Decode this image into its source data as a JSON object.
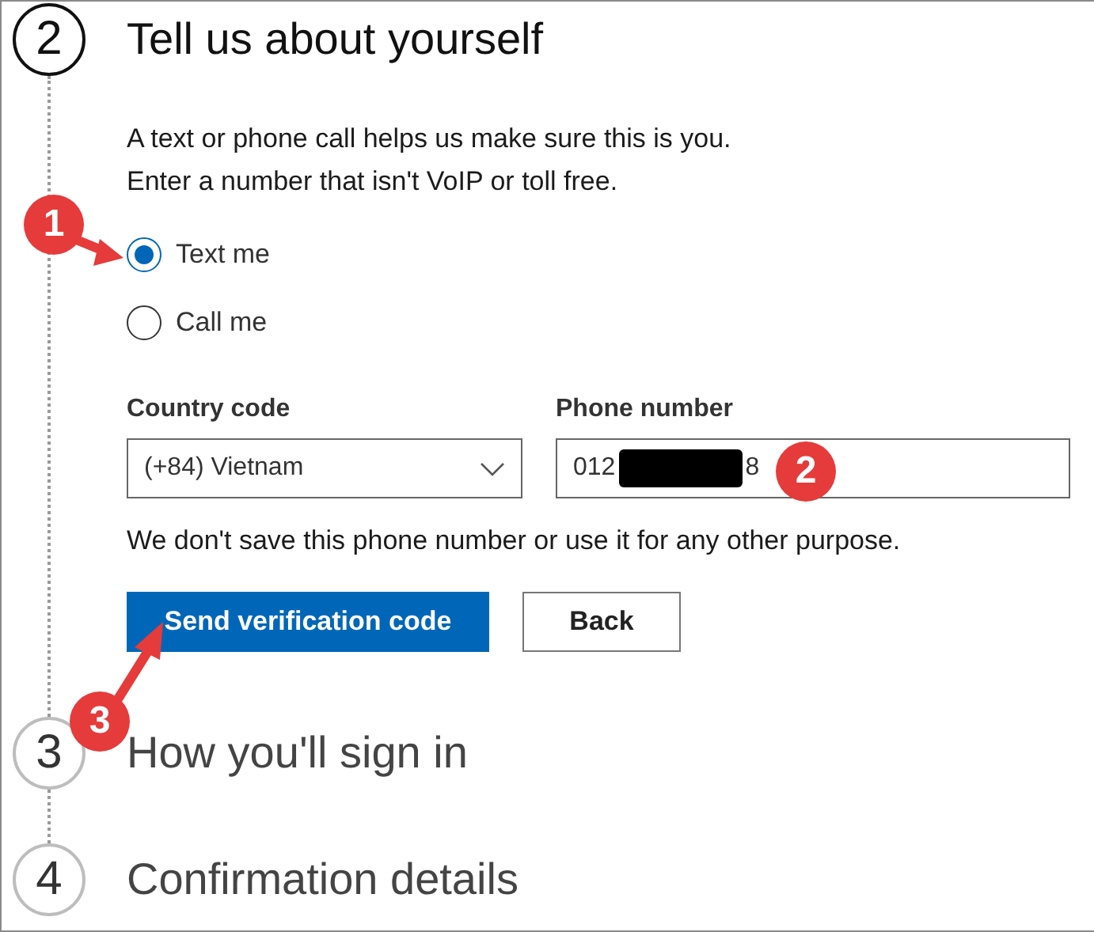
{
  "steps": [
    {
      "number": "2",
      "title": "Tell us about yourself",
      "current": true
    },
    {
      "number": "3",
      "title": "How you'll sign in",
      "current": false
    },
    {
      "number": "4",
      "title": "Confirmation details",
      "current": false
    }
  ],
  "form": {
    "intro": [
      "A text or phone call helps us make sure this is you.",
      "Enter a number that isn't VoIP or toll free."
    ],
    "options": [
      {
        "label": "Text me",
        "selected": true
      },
      {
        "label": "Call me",
        "selected": false
      }
    ],
    "country": {
      "label": "Country code",
      "value": "(+84) Vietnam"
    },
    "phone": {
      "label": "Phone number",
      "value_start": "012",
      "value_end": "8",
      "redacted": true
    },
    "note": "We don't save this phone number or use it for any other purpose.",
    "buttons": [
      {
        "label": "Send verification code",
        "kind": "primary"
      },
      {
        "label": "Back",
        "kind": "secondary"
      }
    ]
  },
  "annotations": [
    {
      "number": "1",
      "arrow": true
    },
    {
      "number": "2",
      "arrow": false
    },
    {
      "number": "3",
      "arrow": true
    }
  ]
}
